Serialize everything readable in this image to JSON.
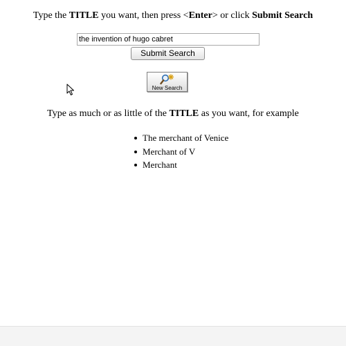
{
  "instruction": {
    "part1": "Type the ",
    "title_word": "TITLE",
    "part2": " you want, then press <",
    "enter_word": "Enter",
    "part3": "> or click ",
    "submit_phrase": "Submit Search"
  },
  "search": {
    "value": "the invention of hugo cabret",
    "submit_label": "Submit Search",
    "new_search_label": "New Search",
    "new_search_icon": "magnifier-sparkle-icon"
  },
  "examples": {
    "intro_part1": "Type as much or as little of the ",
    "intro_title_word": "TITLE",
    "intro_part2": " as you want, for example",
    "items": [
      "The merchant of Venice",
      "Merchant of V",
      "Merchant"
    ]
  },
  "colors": {
    "icon_gold": "#d9a21b",
    "icon_blue": "#2f6fb3"
  }
}
